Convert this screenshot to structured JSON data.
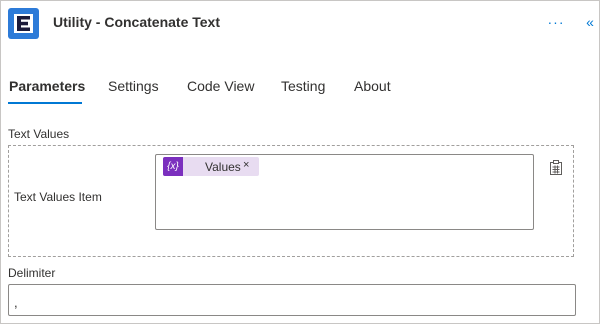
{
  "header": {
    "title": "Utility - Concatenate Text",
    "more_label": "···",
    "collapse_label": "«",
    "icon": "connector-app-icon"
  },
  "tabs": [
    {
      "label": "Parameters",
      "active": true
    },
    {
      "label": "Settings",
      "active": false
    },
    {
      "label": "Code View",
      "active": false
    },
    {
      "label": "Testing",
      "active": false
    },
    {
      "label": "About",
      "active": false
    }
  ],
  "text_values": {
    "section_label": "Text Values",
    "item_label": "Text Values Item",
    "token": {
      "icon_text": "{x}",
      "label": "Values",
      "remove_label": "×"
    }
  },
  "delimiter": {
    "label": "Delimiter",
    "value": ","
  },
  "colors": {
    "accent": "#0078d4",
    "token_bg": "#e8dcf1",
    "token_icon_bg": "#7b2fbe",
    "app_icon_bg": "#2d7bd8"
  }
}
